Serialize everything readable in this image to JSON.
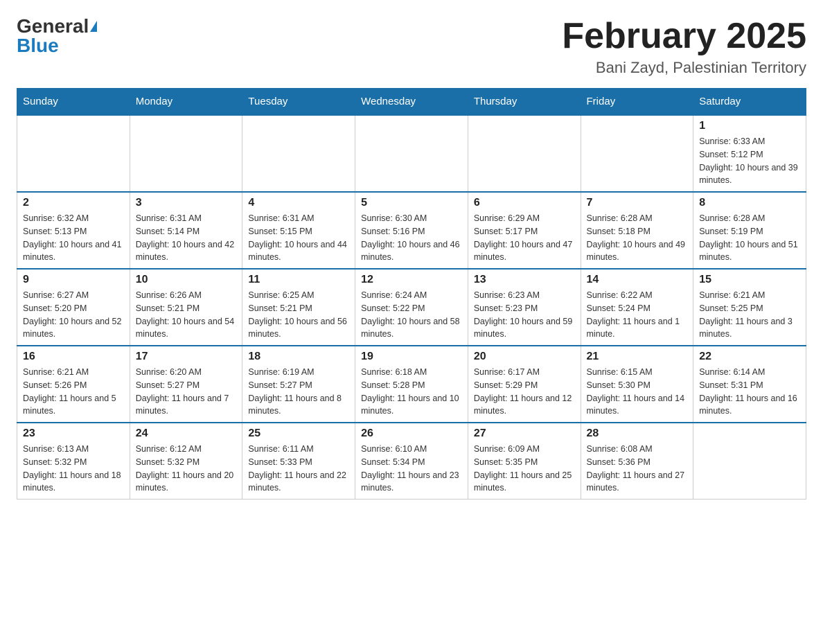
{
  "header": {
    "logo_general": "General",
    "logo_blue": "Blue",
    "month_title": "February 2025",
    "location": "Bani Zayd, Palestinian Territory"
  },
  "days_of_week": [
    "Sunday",
    "Monday",
    "Tuesday",
    "Wednesday",
    "Thursday",
    "Friday",
    "Saturday"
  ],
  "weeks": [
    [
      {
        "day": "",
        "info": ""
      },
      {
        "day": "",
        "info": ""
      },
      {
        "day": "",
        "info": ""
      },
      {
        "day": "",
        "info": ""
      },
      {
        "day": "",
        "info": ""
      },
      {
        "day": "",
        "info": ""
      },
      {
        "day": "1",
        "info": "Sunrise: 6:33 AM\nSunset: 5:12 PM\nDaylight: 10 hours and 39 minutes."
      }
    ],
    [
      {
        "day": "2",
        "info": "Sunrise: 6:32 AM\nSunset: 5:13 PM\nDaylight: 10 hours and 41 minutes."
      },
      {
        "day": "3",
        "info": "Sunrise: 6:31 AM\nSunset: 5:14 PM\nDaylight: 10 hours and 42 minutes."
      },
      {
        "day": "4",
        "info": "Sunrise: 6:31 AM\nSunset: 5:15 PM\nDaylight: 10 hours and 44 minutes."
      },
      {
        "day": "5",
        "info": "Sunrise: 6:30 AM\nSunset: 5:16 PM\nDaylight: 10 hours and 46 minutes."
      },
      {
        "day": "6",
        "info": "Sunrise: 6:29 AM\nSunset: 5:17 PM\nDaylight: 10 hours and 47 minutes."
      },
      {
        "day": "7",
        "info": "Sunrise: 6:28 AM\nSunset: 5:18 PM\nDaylight: 10 hours and 49 minutes."
      },
      {
        "day": "8",
        "info": "Sunrise: 6:28 AM\nSunset: 5:19 PM\nDaylight: 10 hours and 51 minutes."
      }
    ],
    [
      {
        "day": "9",
        "info": "Sunrise: 6:27 AM\nSunset: 5:20 PM\nDaylight: 10 hours and 52 minutes."
      },
      {
        "day": "10",
        "info": "Sunrise: 6:26 AM\nSunset: 5:21 PM\nDaylight: 10 hours and 54 minutes."
      },
      {
        "day": "11",
        "info": "Sunrise: 6:25 AM\nSunset: 5:21 PM\nDaylight: 10 hours and 56 minutes."
      },
      {
        "day": "12",
        "info": "Sunrise: 6:24 AM\nSunset: 5:22 PM\nDaylight: 10 hours and 58 minutes."
      },
      {
        "day": "13",
        "info": "Sunrise: 6:23 AM\nSunset: 5:23 PM\nDaylight: 10 hours and 59 minutes."
      },
      {
        "day": "14",
        "info": "Sunrise: 6:22 AM\nSunset: 5:24 PM\nDaylight: 11 hours and 1 minute."
      },
      {
        "day": "15",
        "info": "Sunrise: 6:21 AM\nSunset: 5:25 PM\nDaylight: 11 hours and 3 minutes."
      }
    ],
    [
      {
        "day": "16",
        "info": "Sunrise: 6:21 AM\nSunset: 5:26 PM\nDaylight: 11 hours and 5 minutes."
      },
      {
        "day": "17",
        "info": "Sunrise: 6:20 AM\nSunset: 5:27 PM\nDaylight: 11 hours and 7 minutes."
      },
      {
        "day": "18",
        "info": "Sunrise: 6:19 AM\nSunset: 5:27 PM\nDaylight: 11 hours and 8 minutes."
      },
      {
        "day": "19",
        "info": "Sunrise: 6:18 AM\nSunset: 5:28 PM\nDaylight: 11 hours and 10 minutes."
      },
      {
        "day": "20",
        "info": "Sunrise: 6:17 AM\nSunset: 5:29 PM\nDaylight: 11 hours and 12 minutes."
      },
      {
        "day": "21",
        "info": "Sunrise: 6:15 AM\nSunset: 5:30 PM\nDaylight: 11 hours and 14 minutes."
      },
      {
        "day": "22",
        "info": "Sunrise: 6:14 AM\nSunset: 5:31 PM\nDaylight: 11 hours and 16 minutes."
      }
    ],
    [
      {
        "day": "23",
        "info": "Sunrise: 6:13 AM\nSunset: 5:32 PM\nDaylight: 11 hours and 18 minutes."
      },
      {
        "day": "24",
        "info": "Sunrise: 6:12 AM\nSunset: 5:32 PM\nDaylight: 11 hours and 20 minutes."
      },
      {
        "day": "25",
        "info": "Sunrise: 6:11 AM\nSunset: 5:33 PM\nDaylight: 11 hours and 22 minutes."
      },
      {
        "day": "26",
        "info": "Sunrise: 6:10 AM\nSunset: 5:34 PM\nDaylight: 11 hours and 23 minutes."
      },
      {
        "day": "27",
        "info": "Sunrise: 6:09 AM\nSunset: 5:35 PM\nDaylight: 11 hours and 25 minutes."
      },
      {
        "day": "28",
        "info": "Sunrise: 6:08 AM\nSunset: 5:36 PM\nDaylight: 11 hours and 27 minutes."
      },
      {
        "day": "",
        "info": ""
      }
    ]
  ]
}
